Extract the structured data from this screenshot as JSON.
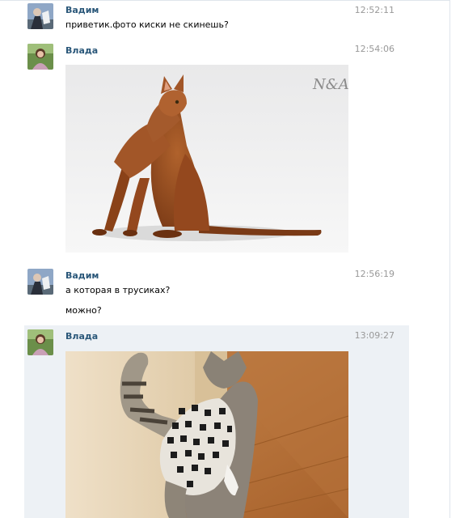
{
  "messages": [
    {
      "author": "Вадим",
      "time": "12:52:11",
      "lines": [
        "приветик.фото киски не скинешь?"
      ]
    },
    {
      "author": "Влада",
      "time": "12:54:06",
      "photo": {
        "watermark": "N&A",
        "subject": "abyssinian-cat"
      }
    },
    {
      "author": "Вадим",
      "time": "12:56:19",
      "lines": [
        "а которая в трусиках?",
        "можно?"
      ]
    },
    {
      "author": "Влада",
      "time": "13:09:27",
      "photo": {
        "subject": "cat-in-pants"
      }
    }
  ],
  "colors": {
    "author": "#2b587a",
    "time": "#999999",
    "highlight": "#edf1f5"
  }
}
